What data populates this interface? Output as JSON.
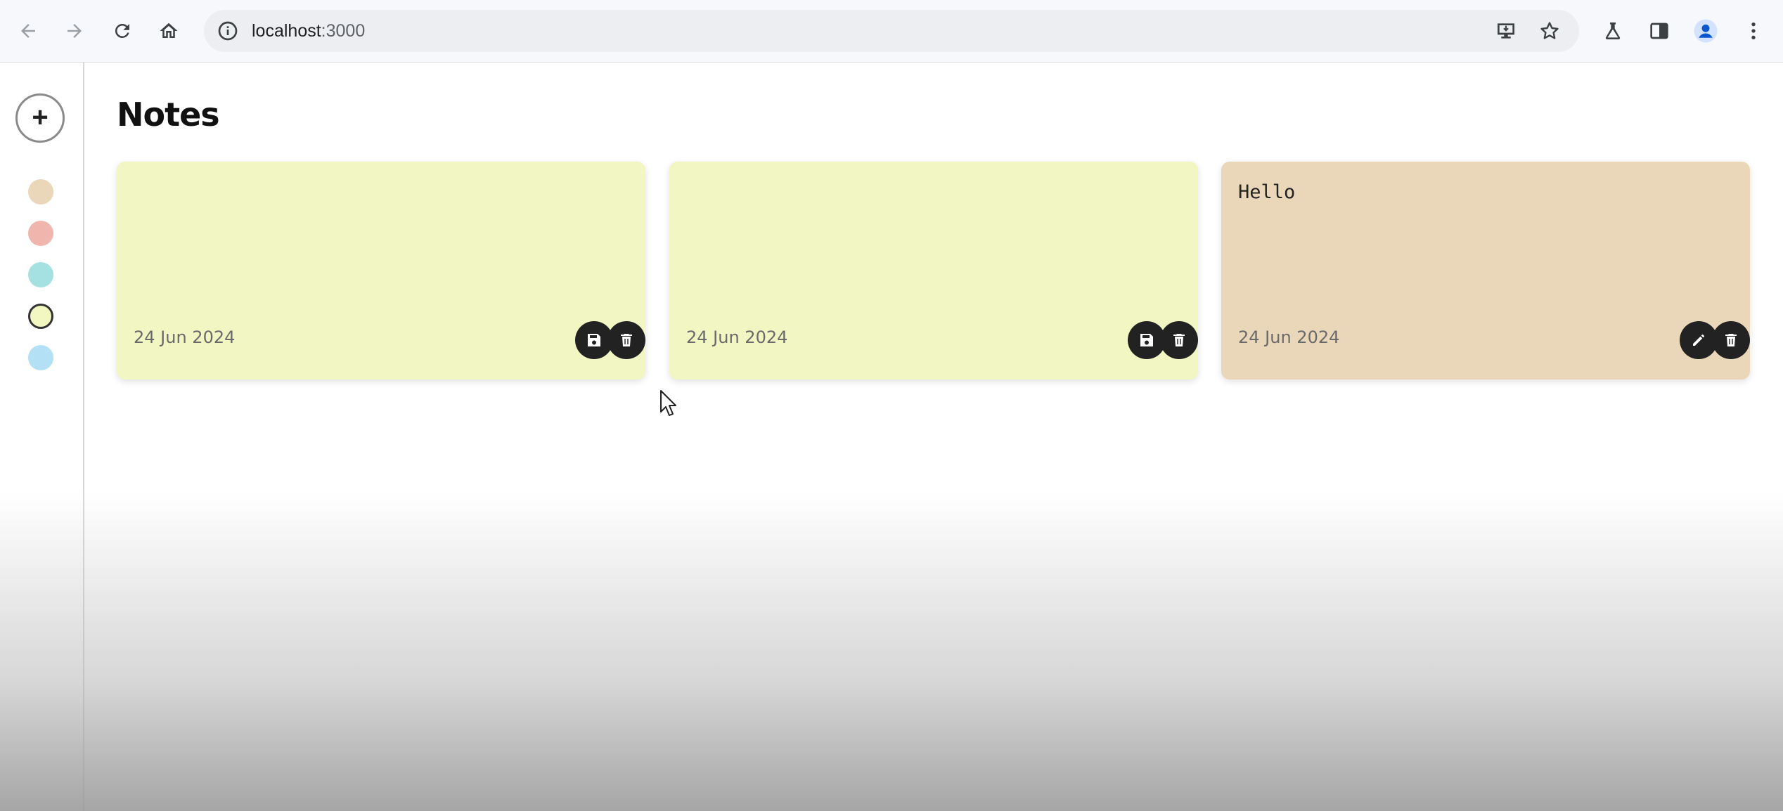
{
  "browser": {
    "url_host": "localhost",
    "url_port": ":3000"
  },
  "sidebar": {
    "add_label": "+",
    "swatches": [
      {
        "color": "#ead6b8"
      },
      {
        "color": "#f0b6ad"
      },
      {
        "color": "#a5e1e0"
      },
      {
        "color": "#f2f6c1",
        "selected": true
      },
      {
        "color": "#b4e0f5"
      }
    ]
  },
  "main": {
    "title": "Notes",
    "notes": [
      {
        "text": "",
        "date": "24 Jun 2024",
        "color": "#f1f6c2",
        "mode": "editing"
      },
      {
        "text": "",
        "date": "24 Jun 2024",
        "color": "#f1f6c2",
        "mode": "editing"
      },
      {
        "text": "Hello",
        "date": "24 Jun 2024",
        "color": "#ead6b8",
        "mode": "view"
      }
    ]
  },
  "icons": {
    "back": "arrow-left-icon",
    "forward": "arrow-right-icon",
    "reload": "reload-icon",
    "home": "home-icon",
    "info": "info-icon",
    "install": "install-app-icon",
    "bookmark": "star-icon",
    "labs": "flask-icon",
    "side_panel": "side-panel-icon",
    "profile": "profile-icon",
    "menu": "kebab-menu-icon",
    "save": "save-icon",
    "delete": "trash-icon",
    "edit": "pencil-icon"
  }
}
